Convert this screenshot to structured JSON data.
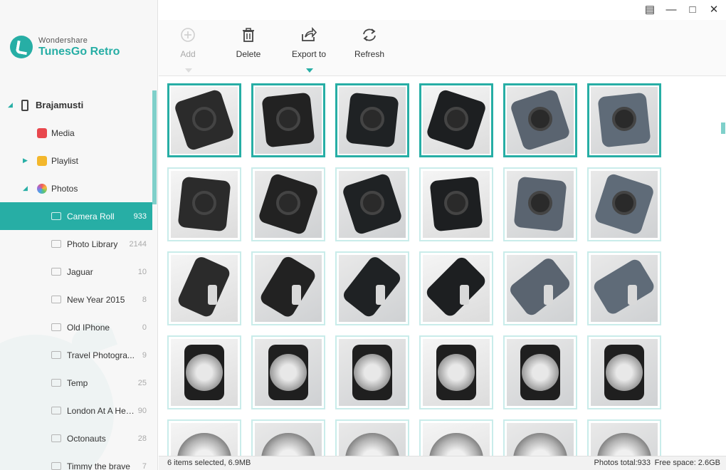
{
  "brand": {
    "company": "Wondershare",
    "product": "TunesGo Retro"
  },
  "colors": {
    "accent": "#27aea5",
    "media": "#e8474d",
    "playlist": "#f3b72c"
  },
  "window_controls": [
    {
      "name": "feedback-icon",
      "glyph": "▤"
    },
    {
      "name": "minimize-icon",
      "glyph": "—"
    },
    {
      "name": "maximize-icon",
      "glyph": "□"
    },
    {
      "name": "close-icon",
      "glyph": "✕"
    }
  ],
  "toolbar": {
    "add": "Add",
    "delete": "Delete",
    "export": "Export to",
    "refresh": "Refresh"
  },
  "sidebar": {
    "device": "Brajamusti",
    "categories": {
      "media": "Media",
      "playlist": "Playlist",
      "photos": "Photos"
    },
    "albums": [
      {
        "label": "Camera Roll",
        "count": "933",
        "active": true,
        "icon": "camera-icon"
      },
      {
        "label": "Photo Library",
        "count": "2144",
        "icon": "photo-library-icon"
      },
      {
        "label": "Jaguar",
        "count": "10",
        "icon": "wifi-album-icon"
      },
      {
        "label": "New Year 2015",
        "count": "8",
        "icon": "wifi-album-icon"
      },
      {
        "label": "Old IPhone",
        "count": "0",
        "icon": "wifi-album-icon"
      },
      {
        "label": "Travel Photogra...",
        "count": "9",
        "icon": "wifi-album-icon"
      },
      {
        "label": "Temp",
        "count": "25",
        "icon": "wifi-album-icon"
      },
      {
        "label": "London At A Height",
        "count": "90",
        "icon": "wifi-album-icon"
      },
      {
        "label": "Octonauts",
        "count": "28",
        "icon": "wifi-album-icon"
      },
      {
        "label": "Timmy the brave",
        "count": "7",
        "icon": "wifi-album-icon"
      }
    ]
  },
  "photos": {
    "selected_count": 6,
    "visible_count": 30
  },
  "status": {
    "selection": "6 items selected, 6.9MB",
    "total": "Photos total:933",
    "free": "Free space: 2.6GB"
  }
}
